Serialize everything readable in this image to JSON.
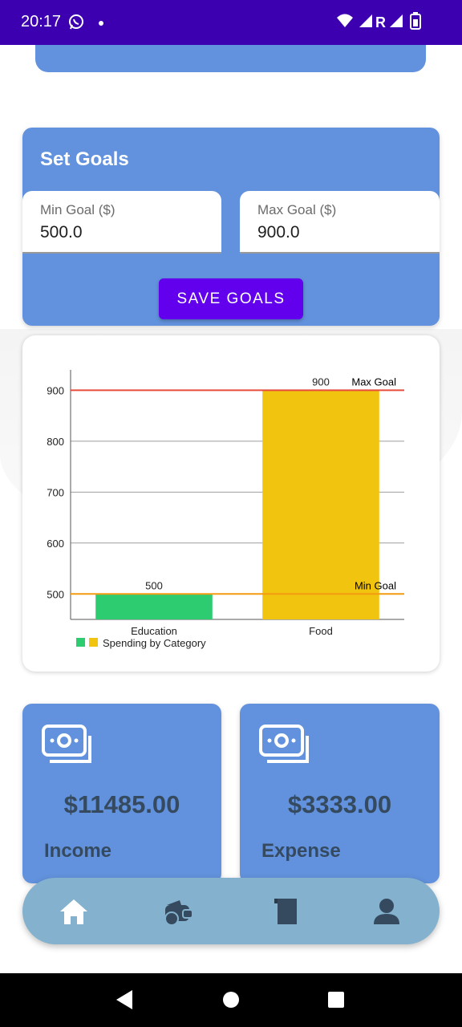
{
  "status_bar": {
    "time": "20:17",
    "network_letter": "R"
  },
  "goals": {
    "title": "Set Goals",
    "min_label": "Min Goal ($)",
    "min_value": "500.0",
    "max_label": "Max Goal ($)",
    "max_value": "900.0",
    "save_label": "SAVE GOALS"
  },
  "chart_data": {
    "type": "bar",
    "categories": [
      "Education",
      "Food"
    ],
    "values": [
      500,
      900
    ],
    "value_labels": [
      "500",
      "900"
    ],
    "colors": [
      "#2ecc71",
      "#f1c40f"
    ],
    "ylim": [
      450,
      940
    ],
    "yticks": [
      500,
      600,
      700,
      800,
      900
    ],
    "legend": "Spending by Category",
    "legend_placement": "bottom-left",
    "grid": true,
    "reference_lines": [
      {
        "label": "Max Goal",
        "value": 900,
        "color": "#e74c3c"
      },
      {
        "label": "Min Goal",
        "value": 500,
        "color": "#f39c12"
      }
    ]
  },
  "income": {
    "amount": "$11485.00",
    "label": "Income",
    "icon": "money-bills-icon"
  },
  "expense": {
    "amount": "$3333.00",
    "label": "Expense",
    "icon": "money-bills-icon"
  },
  "colors": {
    "status_bar": "#3d00b0",
    "card_blue": "#6292dd",
    "button_purple": "#6200ee",
    "nav_bg": "#84b2ce",
    "text_dark": "#354a5f"
  },
  "bottom_nav": {
    "items": [
      {
        "name": "home-icon",
        "active": true
      },
      {
        "name": "wallet-icon",
        "active": false
      },
      {
        "name": "book-icon",
        "active": false
      },
      {
        "name": "profile-icon",
        "active": false
      }
    ]
  }
}
